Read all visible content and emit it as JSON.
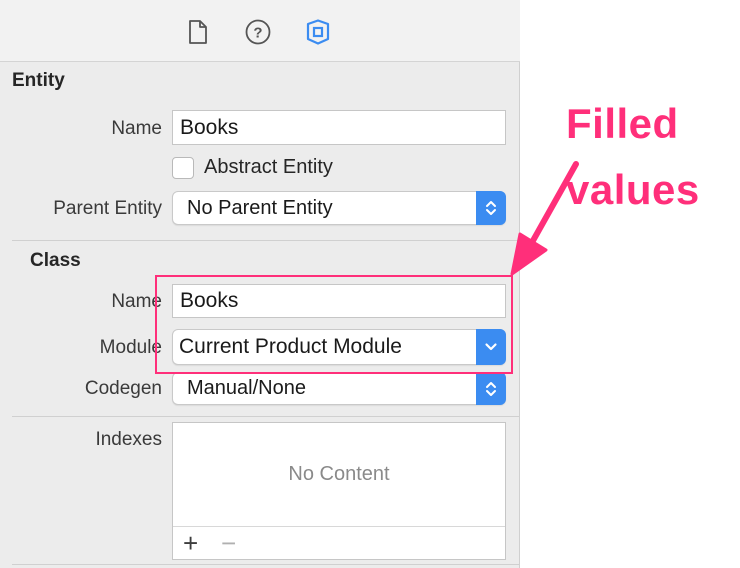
{
  "toolbar": {
    "icons": [
      "file-inspector-icon",
      "quick-help-icon",
      "data-model-inspector-icon"
    ],
    "active_color": "#3b8cf1"
  },
  "entity": {
    "section_title": "Entity",
    "name_label": "Name",
    "name_value": "Books",
    "abstract_label": "Abstract Entity",
    "parent_label": "Parent Entity",
    "parent_value": "No Parent Entity"
  },
  "class": {
    "section_title": "Class",
    "name_label": "Name",
    "name_value": "Books",
    "module_label": "Module",
    "module_value": "Current Product Module",
    "codegen_label": "Codegen",
    "codegen_value": "Manual/None"
  },
  "indexes": {
    "label": "Indexes",
    "empty_text": "No Content",
    "add_symbol": "+",
    "remove_symbol": "−"
  },
  "annotation": {
    "line1": "Filled",
    "line2": "values",
    "color": "#ff2f7a"
  }
}
